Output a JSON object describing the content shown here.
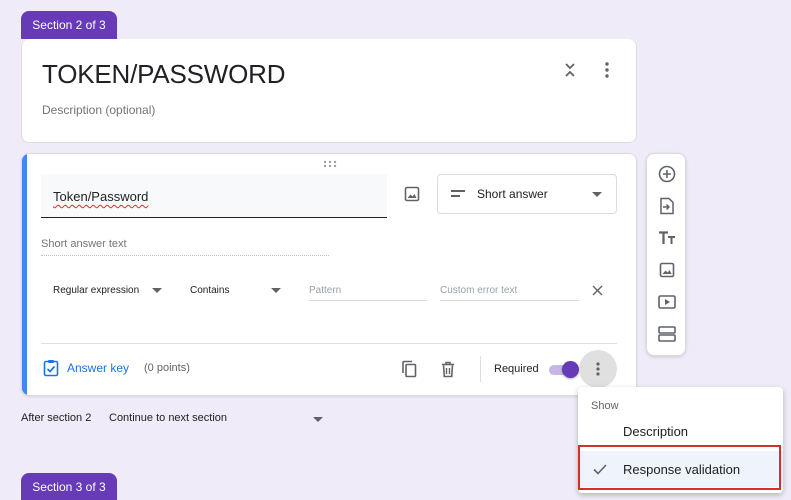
{
  "sections": {
    "current_tab": "Section 2 of 3",
    "next_tab": "Section 3 of 3"
  },
  "section_header": {
    "title": "TOKEN/PASSWORD",
    "description_placeholder": "Description (optional)"
  },
  "question": {
    "title": "Token/Password",
    "type": "Short answer",
    "answer_placeholder": "Short answer text",
    "validation": {
      "type": "Regular expression",
      "condition": "Contains",
      "pattern_placeholder": "Pattern",
      "error_placeholder": "Custom error text"
    },
    "footer": {
      "answer_key": "Answer key",
      "points": "(0 points)",
      "required_label": "Required",
      "required": true
    }
  },
  "after_section": {
    "label": "After section 2",
    "value": "Continue to next section"
  },
  "more_menu": {
    "header": "Show",
    "items": [
      {
        "label": "Description",
        "checked": false
      },
      {
        "label": "Response validation",
        "checked": true
      }
    ]
  },
  "colors": {
    "accent": "#673ab7",
    "background": "#f0ebf8",
    "focus_bar": "#4285f4",
    "link": "#1a73e8",
    "highlight_box": "#d32f2f"
  }
}
